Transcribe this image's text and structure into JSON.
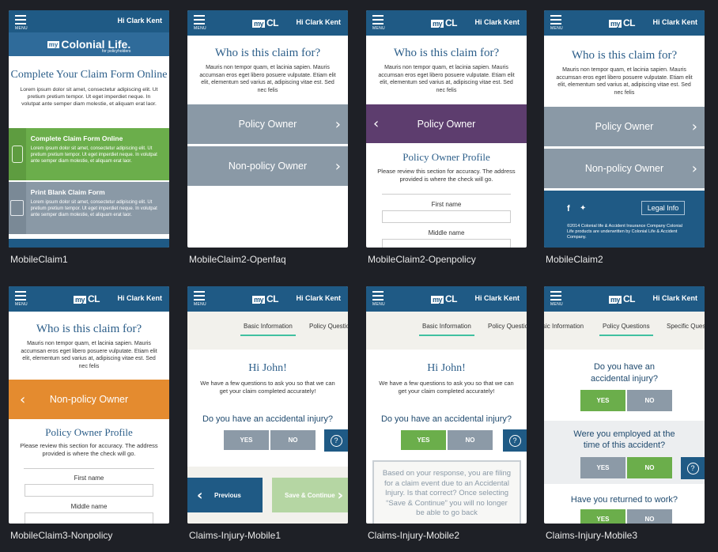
{
  "greeting": "Hi Clark Kent",
  "menu_label": "MENU",
  "logo": {
    "my": "my",
    "cl": "CL",
    "full_my": "my",
    "full_name": "Colonial Life.",
    "tagline": "for policyholders"
  },
  "claim_question": "Who is this claim for?",
  "lorem_short": "Mauris non tempor quam, et lacinia sapien. Mauris accumsan eros eget libero posuere vulputate. Etiam elit elit, elementum sed varius at, adipiscing vitae est. Sed nec felis",
  "policy_owner": "Policy Owner",
  "non_policy_owner": "Non-policy Owner",
  "policy_owner_profile": "Policy Owner Profile",
  "profile_note": "Please review this section for accuracy. The address provided is where the check will go.",
  "first_name": "First name",
  "middle_name": "Middle name",
  "legal_info": "Legal Info",
  "footer_text": "©2014 Colonial life & Accident Insurance Company Colonial Life products are underwritten by Colonial Life & Accident Company.",
  "claim1": {
    "title": "Complete Your Claim Form Online",
    "intro": "Lorem ipsum dolor sit amet, consectetur adipiscing elit. Ut pretium pretium tempor. Ut eget imperdiet neque. In volutpat ante semper diam molestie, et aliquam erat laor.",
    "online_title": "Complete Claim Form Online",
    "online_text": "Lorem ipsum dolor sit amet, consectetur adipiscing elit. Ut pretium pretium tempor. Ut eget imperdiet neque. In volutpat ante semper diam molestie, et aliquam erat laor.",
    "print_title": "Print Blank Claim Form",
    "print_text": "Lorem ipsum dolor sit amet, consectetur adipiscing elit. Ut pretium pretium tempor. Ut eget imperdiet neque. In volutpat ante semper diam molestie, et aliquam erat laor."
  },
  "injury": {
    "tab_basic": "Basic Information",
    "tab_policy": "Policy Questio",
    "tab_basic_cut": "sic Information",
    "tab_policy_full": "Policy Questions",
    "tab_specific": "Specific Ques",
    "hi": "Hi John!",
    "intro": "We have a few questions to ask you so that we can get your claim completed accurately!",
    "q_accident": "Do you have an accidental injury?",
    "yes": "YES",
    "no": "NO",
    "help": "?",
    "previous": "Previous",
    "save_continue": "Save & Continue",
    "notice": "Based on your response, you are filing for a claim event due to an Accidental Injury. Is that correct? Once selecting “Save & Continue” you will no longer be able to go back",
    "q_accident3a": "Do you have an",
    "q_accident3b": "accidental injury?",
    "q_employed": "Were you employed at the time of this accident?",
    "q_returned": "Have you returned to work?"
  },
  "captions": [
    "MobileClaim1",
    "MobileClaim2-Openfaq",
    "MobileClaim2-Openpolicy",
    "MobileClaim2",
    "MobileClaim3-Nonpolicy",
    "Claims-Injury-Mobile1",
    "Claims-Injury-Mobile2",
    "Claims-Injury-Mobile3"
  ],
  "colors": {
    "navy": "#1f5a85",
    "green": "#6bae4b",
    "gray": "#8a99a6",
    "purple": "#5d3d6e",
    "orange": "#e48b2f",
    "light_green": "#b5d6a3"
  }
}
